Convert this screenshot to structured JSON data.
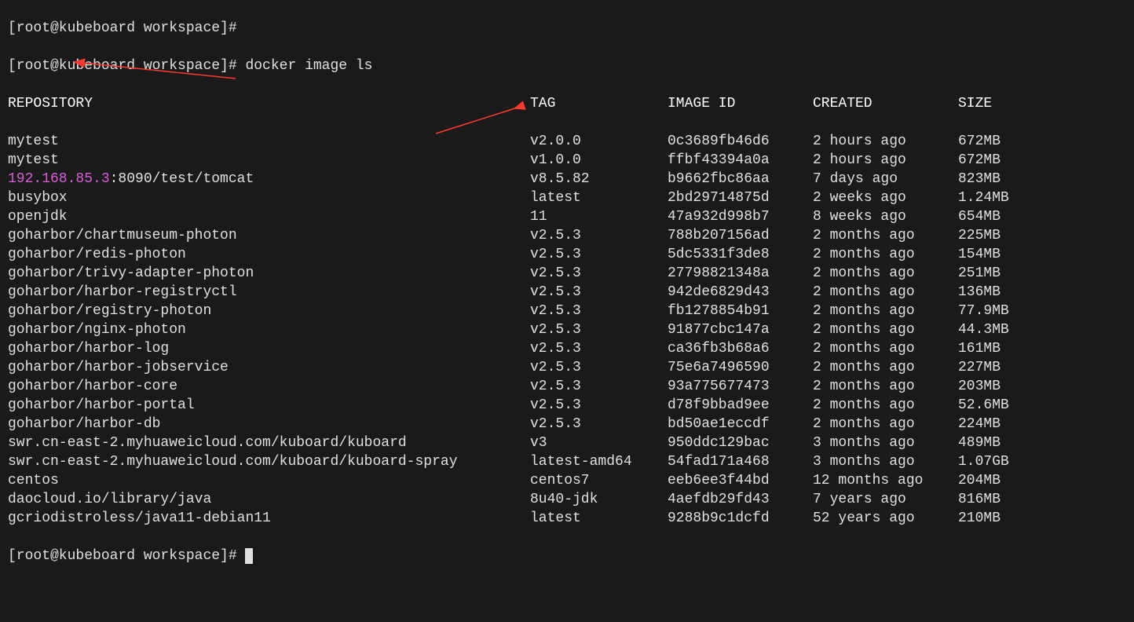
{
  "prompts": {
    "line0": "[root@kubeboard workspace]#",
    "line1_prefix": "[root@kubeboard workspace]# ",
    "line1_cmd": "docker image ls",
    "line_last": "[root@kubeboard workspace]# "
  },
  "headers": {
    "repo": "REPOSITORY",
    "tag": "TAG",
    "id": "IMAGE ID",
    "created": "CREATED",
    "size": "SIZE"
  },
  "rows": [
    {
      "repo": "mytest",
      "tag": "v2.0.0",
      "id": "0c3689fb46d6",
      "created": "2 hours ago",
      "size": "672MB"
    },
    {
      "repo": "mytest",
      "tag": "v1.0.0",
      "id": "ffbf43394a0a",
      "created": "2 hours ago",
      "size": "672MB"
    },
    {
      "repo_ip": "192.168.85.3",
      "repo_rest": ":8090/test/tomcat",
      "tag": "v8.5.82",
      "id": "b9662fbc86aa",
      "created": "7 days ago",
      "size": "823MB"
    },
    {
      "repo": "busybox",
      "tag": "latest",
      "id": "2bd29714875d",
      "created": "2 weeks ago",
      "size": "1.24MB"
    },
    {
      "repo": "openjdk",
      "tag": "11",
      "id": "47a932d998b7",
      "created": "8 weeks ago",
      "size": "654MB"
    },
    {
      "repo": "goharbor/chartmuseum-photon",
      "tag": "v2.5.3",
      "id": "788b207156ad",
      "created": "2 months ago",
      "size": "225MB"
    },
    {
      "repo": "goharbor/redis-photon",
      "tag": "v2.5.3",
      "id": "5dc5331f3de8",
      "created": "2 months ago",
      "size": "154MB"
    },
    {
      "repo": "goharbor/trivy-adapter-photon",
      "tag": "v2.5.3",
      "id": "27798821348a",
      "created": "2 months ago",
      "size": "251MB"
    },
    {
      "repo": "goharbor/harbor-registryctl",
      "tag": "v2.5.3",
      "id": "942de6829d43",
      "created": "2 months ago",
      "size": "136MB"
    },
    {
      "repo": "goharbor/registry-photon",
      "tag": "v2.5.3",
      "id": "fb1278854b91",
      "created": "2 months ago",
      "size": "77.9MB"
    },
    {
      "repo": "goharbor/nginx-photon",
      "tag": "v2.5.3",
      "id": "91877cbc147a",
      "created": "2 months ago",
      "size": "44.3MB"
    },
    {
      "repo": "goharbor/harbor-log",
      "tag": "v2.5.3",
      "id": "ca36fb3b68a6",
      "created": "2 months ago",
      "size": "161MB"
    },
    {
      "repo": "goharbor/harbor-jobservice",
      "tag": "v2.5.3",
      "id": "75e6a7496590",
      "created": "2 months ago",
      "size": "227MB"
    },
    {
      "repo": "goharbor/harbor-core",
      "tag": "v2.5.3",
      "id": "93a775677473",
      "created": "2 months ago",
      "size": "203MB"
    },
    {
      "repo": "goharbor/harbor-portal",
      "tag": "v2.5.3",
      "id": "d78f9bbad9ee",
      "created": "2 months ago",
      "size": "52.6MB"
    },
    {
      "repo": "goharbor/harbor-db",
      "tag": "v2.5.3",
      "id": "bd50ae1eccdf",
      "created": "2 months ago",
      "size": "224MB"
    },
    {
      "repo": "swr.cn-east-2.myhuaweicloud.com/kuboard/kuboard",
      "tag": "v3",
      "id": "950ddc129bac",
      "created": "3 months ago",
      "size": "489MB"
    },
    {
      "repo": "swr.cn-east-2.myhuaweicloud.com/kuboard/kuboard-spray",
      "tag": "latest-amd64",
      "id": "54fad171a468",
      "created": "3 months ago",
      "size": "1.07GB"
    },
    {
      "repo": "centos",
      "tag": "centos7",
      "id": "eeb6ee3f44bd",
      "created": "12 months ago",
      "size": "204MB"
    },
    {
      "repo": "daocloud.io/library/java",
      "tag": "8u40-jdk",
      "id": "4aefdb29fd43",
      "created": "7 years ago",
      "size": "816MB"
    },
    {
      "repo": "gcriodistroless/java11-debian11",
      "tag": "latest",
      "id": "9288b9c1dcfd",
      "created": "52 years ago",
      "size": "210MB"
    }
  ],
  "annotations": {
    "arrow_color": "#ff3b30"
  }
}
